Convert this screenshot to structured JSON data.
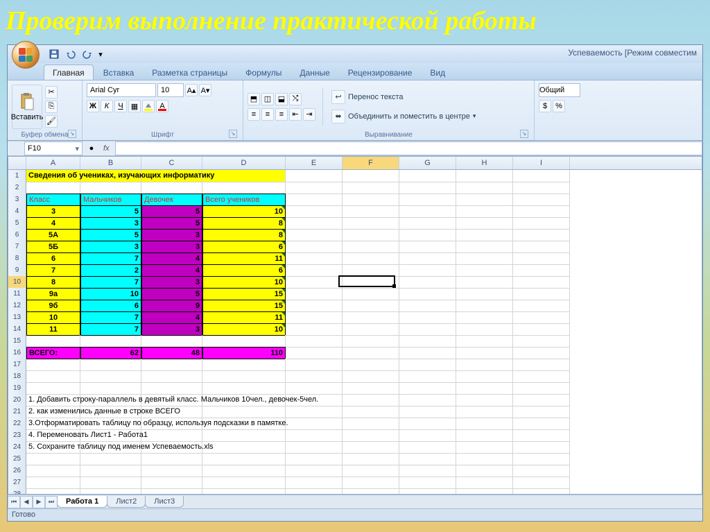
{
  "slide_title": "Проверим выполнение практической работы",
  "window_title": "Успеваемость [Режим совместим",
  "qat": {
    "save": "",
    "undo": "",
    "redo": ""
  },
  "tabs": [
    "Главная",
    "Вставка",
    "Разметка страницы",
    "Формулы",
    "Данные",
    "Рецензирование",
    "Вид"
  ],
  "active_tab": 0,
  "ribbon": {
    "clipboard": {
      "paste": "Вставить",
      "label": "Буфер обмена"
    },
    "font": {
      "name": "Arial Cyr",
      "size": "10",
      "label": "Шрифт",
      "bold": "Ж",
      "italic": "К",
      "underline": "Ч"
    },
    "alignment": {
      "wrap": "Перенос текста",
      "merge": "Объединить и поместить в центре",
      "label": "Выравнивание"
    },
    "number": {
      "format": "Общий"
    }
  },
  "namebox": "F10",
  "formula": "",
  "columns": [
    "",
    "A",
    "B",
    "C",
    "D",
    "E",
    "F",
    "G",
    "H",
    "I"
  ],
  "selected_col_index": 6,
  "selected_row": 10,
  "chart_data": {
    "type": "table",
    "title": "Сведения об учениках, изучающих информатику",
    "headers": [
      "Класс",
      "Мальчиков",
      "Девочек",
      "Всего учеников"
    ],
    "rows": [
      {
        "class": "3",
        "boys": 5,
        "girls": 5,
        "total": 10
      },
      {
        "class": "4",
        "boys": 3,
        "girls": 5,
        "total": 8
      },
      {
        "class": "5А",
        "boys": 5,
        "girls": 3,
        "total": 8
      },
      {
        "class": "5Б",
        "boys": 3,
        "girls": 3,
        "total": 6
      },
      {
        "class": "6",
        "boys": 7,
        "girls": 4,
        "total": 11
      },
      {
        "class": "7",
        "boys": 2,
        "girls": 4,
        "total": 6
      },
      {
        "class": "8",
        "boys": 7,
        "girls": 3,
        "total": 10
      },
      {
        "class": "9а",
        "boys": 10,
        "girls": 5,
        "total": 15
      },
      {
        "class": "9б",
        "boys": 6,
        "girls": 9,
        "total": 15
      },
      {
        "class": "10",
        "boys": 7,
        "girls": 4,
        "total": 11
      },
      {
        "class": "11",
        "boys": 7,
        "girls": 3,
        "total": 10
      }
    ],
    "totals": {
      "label": "ВСЕГО:",
      "boys": 62,
      "girls": 48,
      "total": 110
    }
  },
  "notes": [
    "1. Добавить строку-параллель в девятый  класс. Мальчиков 10чел., девочек-5чел.",
    "2. как изменились данные в строке ВСЕГО",
    "3.Отформатировать таблицу по образцу, используя подсказки в памятке.",
    "4. Переменовать Лист1 -  Работа1",
    "5.  Сохраните таблицу под именем Успеваемость.xls"
  ],
  "sheets": [
    "Работа 1",
    "Лист2",
    "Лист3"
  ],
  "active_sheet": 0,
  "status": "Готово"
}
